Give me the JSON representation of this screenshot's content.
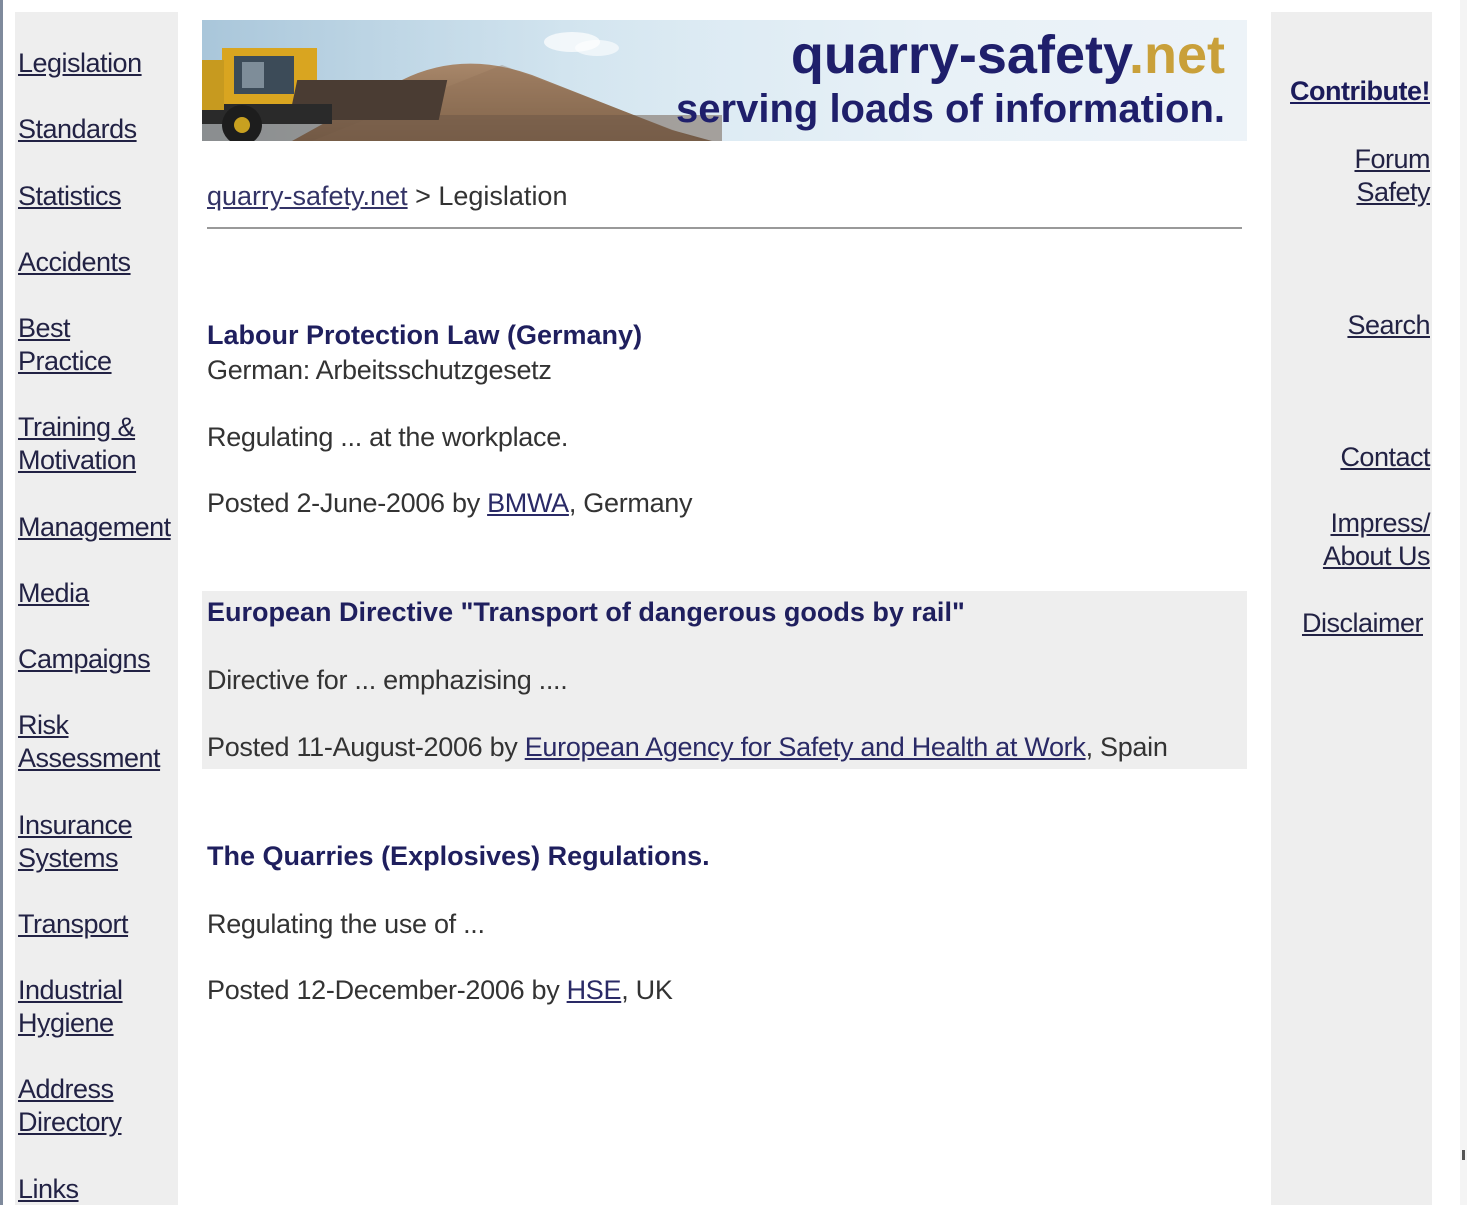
{
  "banner": {
    "site_name": "quarry-safety",
    "site_tld": ".net",
    "tagline": "serving loads of information."
  },
  "left_nav": {
    "items": [
      {
        "line1": "Legislation"
      },
      {
        "line1": "Standards"
      },
      {
        "line1": "Statistics"
      },
      {
        "line1": "Accidents"
      },
      {
        "line1": "Best",
        "line2": "Practice"
      },
      {
        "line1": "Training &",
        "line2": "Motivation"
      },
      {
        "line1": "Management"
      },
      {
        "line1": "Media"
      },
      {
        "line1": "Campaigns"
      },
      {
        "line1": "Risk",
        "line2": "Assessment"
      },
      {
        "line1": "Insurance",
        "line2": "Systems"
      },
      {
        "line1": "Transport"
      },
      {
        "line1": "Industrial",
        "line2": "Hygiene"
      },
      {
        "line1": "Address",
        "line2": "Directory"
      },
      {
        "line1": "Links"
      }
    ]
  },
  "right_nav": {
    "contribute": "Contribute!",
    "forum_line1": "Forum",
    "forum_line2": "Safety",
    "search": "Search",
    "contact": "Contact",
    "impress_line1": "Impress/",
    "impress_line2": "About Us",
    "disclaimer": "Disclaimer"
  },
  "breadcrumb": {
    "home": "quarry-safety.net",
    "separator": " > ",
    "current": "Legislation"
  },
  "entries": [
    {
      "title": "Labour Protection Law (Germany)",
      "subtitle": "German: Arbeitsschutzgesetz",
      "summary": "Regulating ... at the workplace.",
      "posted_prefix": "Posted 2-June-2006 by ",
      "author": "BMWA",
      "location": ", Germany"
    },
    {
      "title": "European Directive \"Transport of dangerous goods by rail\"",
      "summary": "Directive for ... emphazising ....",
      "posted_prefix": "Posted 11-August-2006 by ",
      "author": "European Agency for Safety and Health at Work",
      "location": ", Spain"
    },
    {
      "title": "The Quarries (Explosives) Regulations.",
      "summary": "Regulating the use of ...",
      "posted_prefix": "Posted 12-December-2006 by ",
      "author": "HSE",
      "location": ", UK"
    }
  ],
  "colors": {
    "nav_background": "#eeeeee",
    "title_navy": "#1f1f6b",
    "tld_gold": "#c9a03a",
    "shaded_entry": "#eeeeee"
  }
}
